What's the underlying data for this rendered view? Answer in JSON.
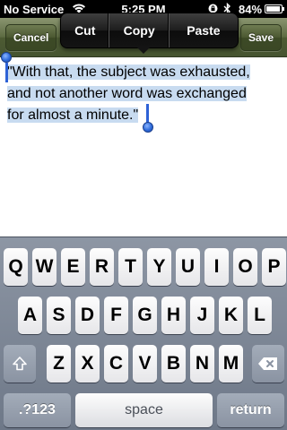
{
  "status_bar": {
    "carrier": "No Service",
    "time": "5:25 PM",
    "battery_percent": "84%"
  },
  "nav_bar": {
    "cancel_label": "Cancel",
    "save_label": "Save"
  },
  "edit_menu": {
    "cut_label": "Cut",
    "copy_label": "Copy",
    "paste_label": "Paste"
  },
  "text": {
    "line1": "\"With that, the subject was exhausted,",
    "line2": "and not another word was exchanged",
    "line3": "for almost a minute.\""
  },
  "keyboard": {
    "row1": [
      "Q",
      "W",
      "E",
      "R",
      "T",
      "Y",
      "U",
      "I",
      "O",
      "P"
    ],
    "row2": [
      "A",
      "S",
      "D",
      "F",
      "G",
      "H",
      "J",
      "K",
      "L"
    ],
    "row3": [
      "Z",
      "X",
      "C",
      "V",
      "B",
      "N",
      "M"
    ],
    "numbers_label": ".?123",
    "space_label": "space",
    "return_label": "return",
    "shift_icon": "shift-arrow-icon",
    "delete_icon": "backspace-icon"
  },
  "colors": {
    "nav_bar": "#5d6b42",
    "selection": "#c8dbf0",
    "handle": "#2e62d6"
  }
}
